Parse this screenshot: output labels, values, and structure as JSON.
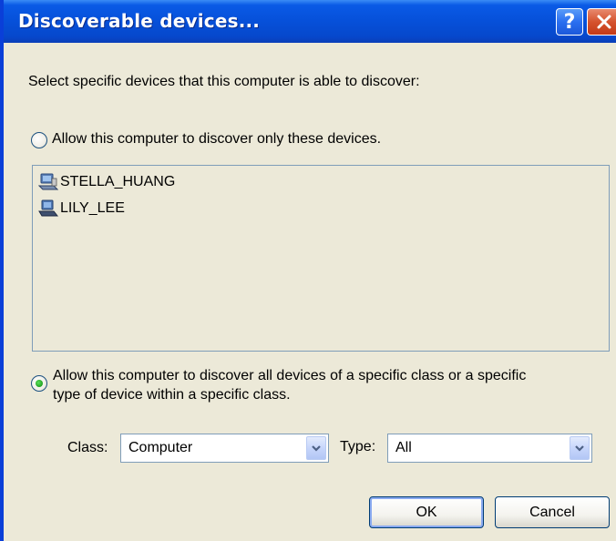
{
  "window": {
    "title": "Discoverable devices...",
    "help_label": "?"
  },
  "dialog": {
    "instruction": "Select specific devices that this computer is able to discover:",
    "radio_specific_devices": {
      "label": "Allow this computer to discover only these devices.",
      "checked": false
    },
    "devices": [
      {
        "name": "STELLA_HUANG",
        "icon": "computer-icon"
      },
      {
        "name": "LILY_LEE",
        "icon": "laptop-icon"
      }
    ],
    "radio_class": {
      "label_line1": "Allow this computer to discover all devices of a specific class or a specific",
      "label_line2": "type of device within a specific class.",
      "checked": true
    },
    "class_label": "Class:",
    "class_value": "Computer",
    "type_label": "Type:",
    "type_value": "All",
    "ok_label": "OK",
    "cancel_label": "Cancel"
  },
  "colors": {
    "titlebar": "#0650d9",
    "dialog_bg": "#ece9d8",
    "close_button": "#d5532e",
    "radio_dot": "#21a121"
  }
}
